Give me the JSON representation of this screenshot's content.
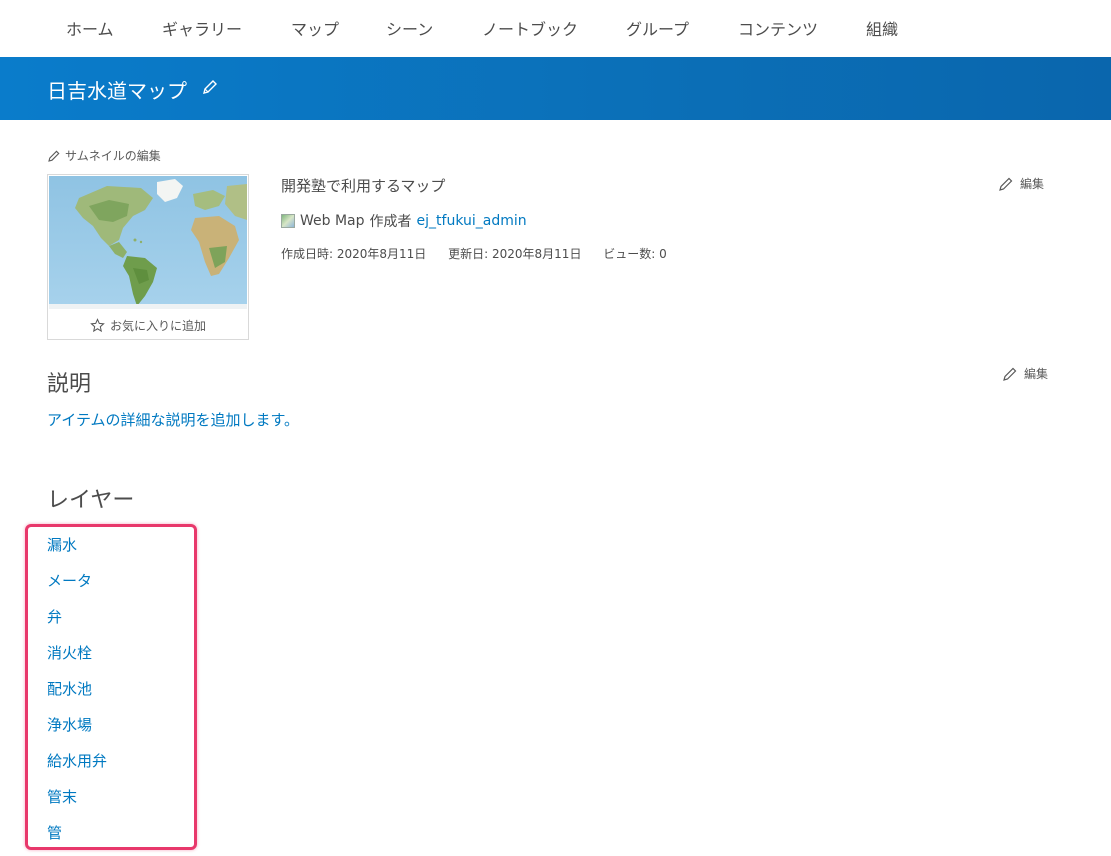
{
  "nav": {
    "items": [
      "ホーム",
      "ギャラリー",
      "マップ",
      "シーン",
      "ノートブック",
      "グループ",
      "コンテンツ",
      "組織"
    ]
  },
  "header": {
    "title": "日吉水道マップ"
  },
  "thumbnail": {
    "edit_label": "サムネイルの編集",
    "favorite_label": "お気に入りに追加"
  },
  "item": {
    "summary": "開発塾で利用するマップ",
    "type": "Web Map",
    "owner_prefix": "作成者",
    "owner": "ej_tfukui_admin",
    "created": "作成日時: 2020年8月11日",
    "modified": "更新日: 2020年8月11日",
    "views": "ビュー数: 0",
    "edit_label": "編集"
  },
  "description": {
    "heading": "説明",
    "add_link": "アイテムの詳細な説明を追加します。",
    "edit_label": "編集"
  },
  "layers": {
    "heading": "レイヤー",
    "items": [
      "漏水",
      "メータ",
      "弁",
      "消火栓",
      "配水池",
      "浄水場",
      "給水用弁",
      "管末",
      "管"
    ]
  },
  "colors": {
    "banner": "#0a75c2",
    "link": "#0079c1",
    "highlight": "#e8386b"
  }
}
